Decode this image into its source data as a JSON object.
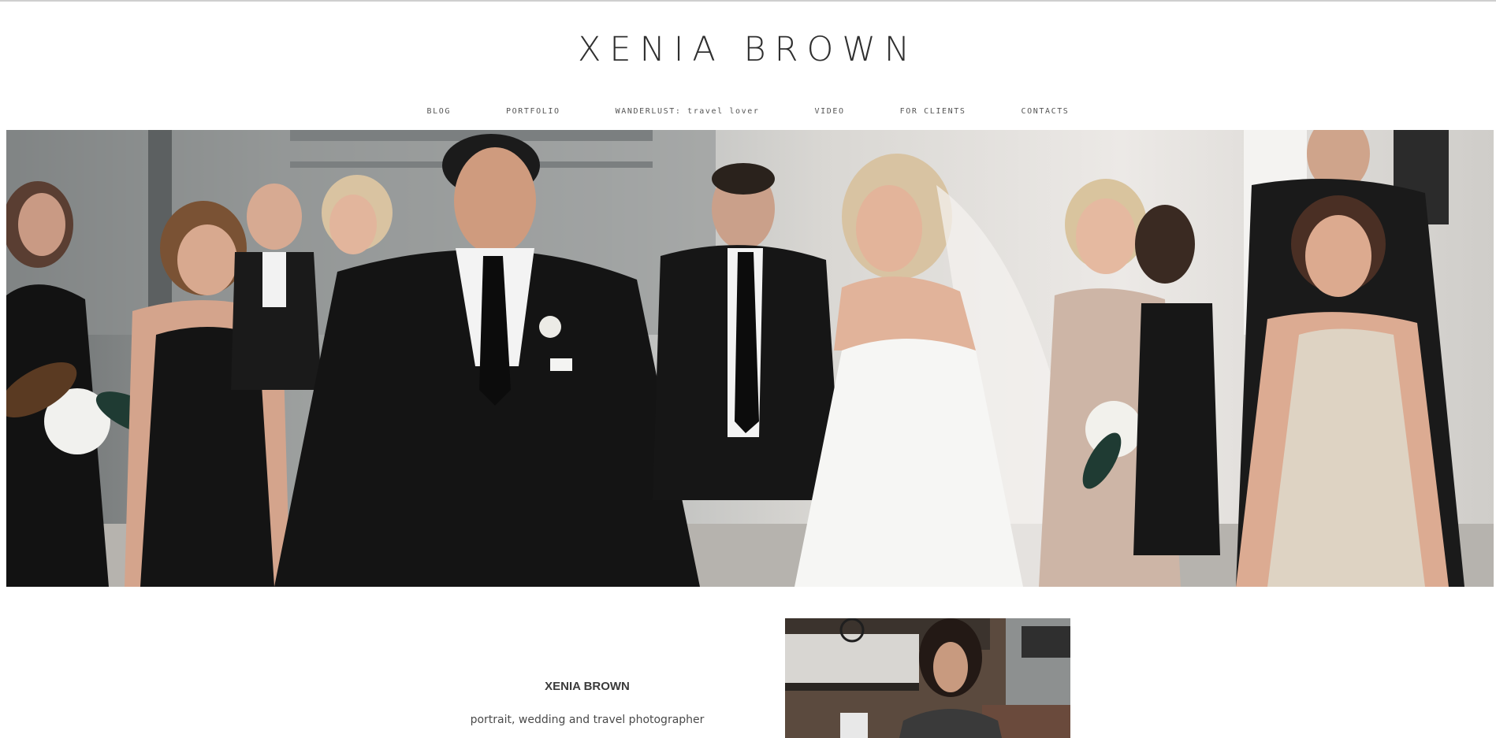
{
  "header": {
    "site_title": "XENIA BROWN"
  },
  "nav": {
    "items": [
      {
        "label": "BLOG"
      },
      {
        "label": "PORTFOLIO"
      },
      {
        "label": "WANDERLUST: travel lover"
      },
      {
        "label": "VIDEO"
      },
      {
        "label": "FOR CLIENTS"
      },
      {
        "label": "CONTACTS"
      }
    ]
  },
  "about": {
    "name": "XENIA BROWN",
    "tagline": "portrait, wedding and travel photographer"
  },
  "colors": {
    "text": "#2f2f2f",
    "nav_text": "#555555",
    "background": "#ffffff"
  }
}
